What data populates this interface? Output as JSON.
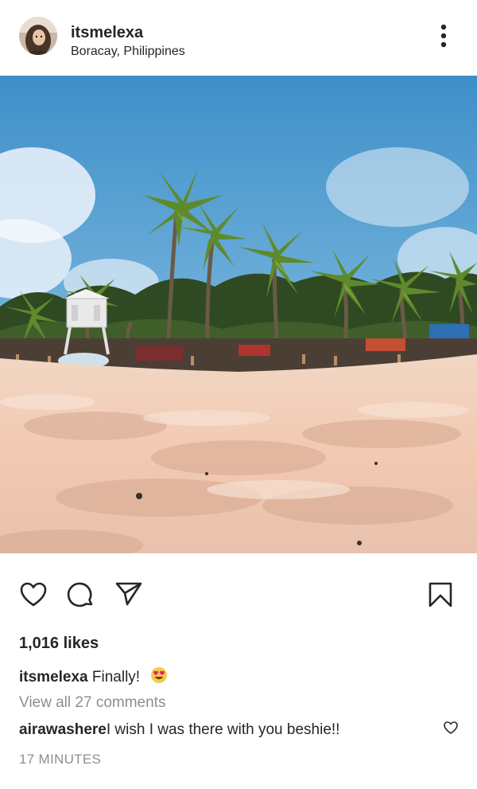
{
  "post": {
    "username": "itsmelexa",
    "location": "Boracay, Philippines"
  },
  "header_icons": {
    "avatar": "profile-avatar",
    "more": "more-vertical-icon"
  },
  "photo": {
    "subject": "beach-palm-trees-lifeguard-tower"
  },
  "action_icons": [
    "heart-icon",
    "comment-icon",
    "share-icon",
    "bookmark-icon"
  ],
  "likes": "1,016 likes",
  "caption": {
    "username": "itsmelexa",
    "text": "Finally!",
    "emoji": "heart-eyes-emoji"
  },
  "view_all_comments": "View all 27 comments",
  "comment": {
    "username": "airawashere",
    "text": "I wish I was there with you beshie!!"
  },
  "timestamp": "17 MINUTES",
  "colors": {
    "text": "#262626",
    "muted": "#8e8e8e",
    "background": "#ffffff"
  }
}
